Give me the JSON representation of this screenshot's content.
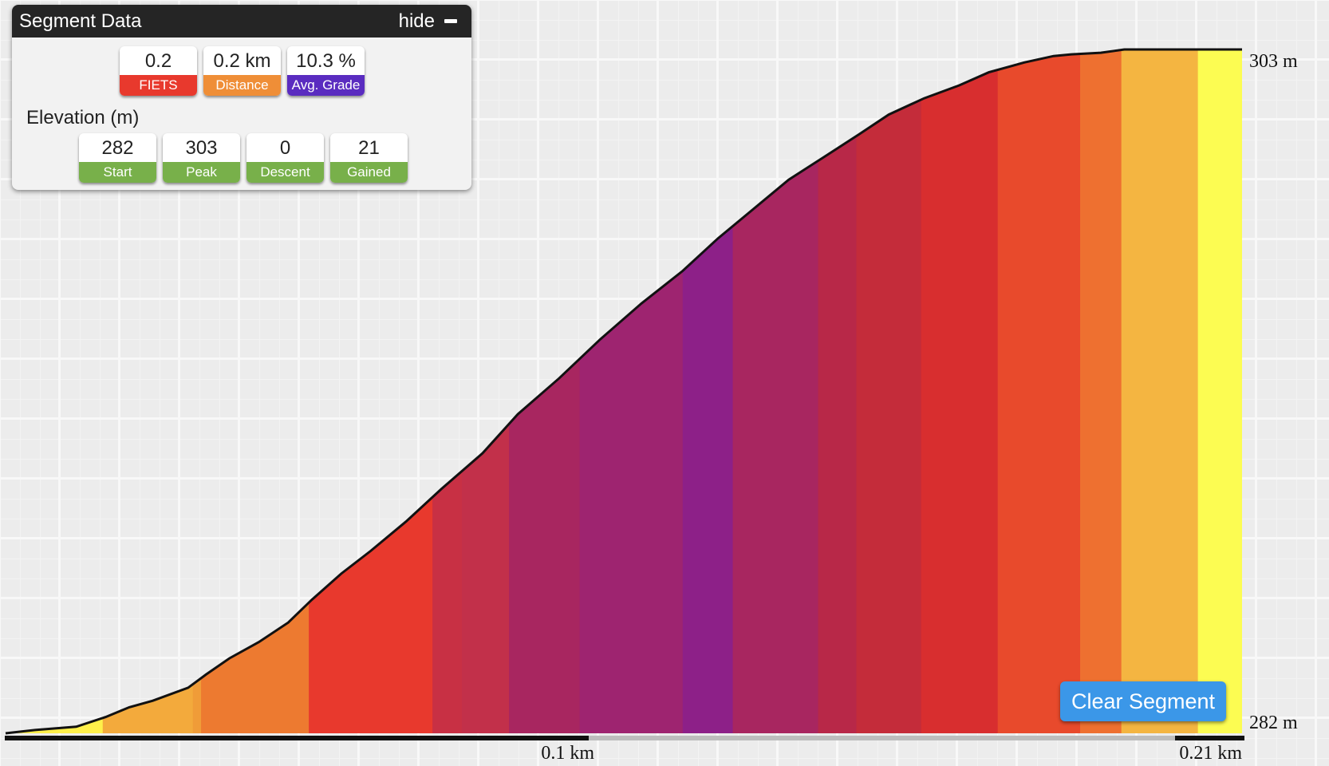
{
  "panel": {
    "title": "Segment Data",
    "hide_label": "hide",
    "hide_icon": "minus-icon",
    "summary": [
      {
        "value": "0.2",
        "label": "FIETS",
        "color": "#e8392d"
      },
      {
        "value": "0.2 km",
        "label": "Distance",
        "color": "#ef8e37"
      },
      {
        "value": "10.3 %",
        "label": "Avg. Grade",
        "color": "#5a2cc0"
      }
    ],
    "elevation_label": "Elevation (m)",
    "elevation": [
      {
        "value": "282",
        "label": "Start",
        "color": "#78b04a"
      },
      {
        "value": "303",
        "label": "Peak",
        "color": "#78b04a"
      },
      {
        "value": "0",
        "label": "Descent",
        "color": "#78b04a"
      },
      {
        "value": "21",
        "label": "Gained",
        "color": "#78b04a"
      }
    ]
  },
  "clear_button": "Clear Segment",
  "chart_data": {
    "type": "area",
    "title": "",
    "xlabel": "",
    "ylabel": "",
    "x_unit": "km",
    "y_unit": "m",
    "xlim": [
      0,
      0.21
    ],
    "ylim": [
      282,
      303
    ],
    "x_ticks": [
      {
        "value": 0.1,
        "label": "0.1 km"
      },
      {
        "value": 0.21,
        "label": "0.21 km"
      }
    ],
    "y_ticks": [
      {
        "value": 303,
        "label": "303 m"
      },
      {
        "value": 282,
        "label": "282 m"
      }
    ],
    "profile": {
      "x": [
        0,
        0.005,
        0.012,
        0.017,
        0.021,
        0.025,
        0.031,
        0.034,
        0.038,
        0.043,
        0.048,
        0.052,
        0.057,
        0.062,
        0.068,
        0.074,
        0.081,
        0.087,
        0.094,
        0.101,
        0.108,
        0.115,
        0.121,
        0.127,
        0.133,
        0.139,
        0.145,
        0.15,
        0.156,
        0.162,
        0.167,
        0.173,
        0.178,
        0.181,
        0.186,
        0.19,
        0.194,
        0.199,
        0.202,
        0.205,
        0.21
      ],
      "y": [
        282.0,
        282.1,
        282.2,
        282.5,
        282.8,
        283.0,
        283.4,
        283.8,
        284.3,
        284.8,
        285.4,
        286.1,
        286.9,
        287.6,
        288.5,
        289.5,
        290.6,
        291.8,
        292.9,
        294.1,
        295.2,
        296.2,
        297.2,
        298.1,
        299.0,
        299.7,
        300.4,
        301.0,
        301.5,
        301.9,
        302.3,
        302.6,
        302.8,
        302.85,
        302.9,
        303.0,
        303.0,
        303.0,
        303.0,
        303.0,
        303.0
      ]
    },
    "grade_bands": [
      {
        "x0": 0,
        "x1": 0.0165,
        "color": "#fff04a"
      },
      {
        "x0": 0.0165,
        "x1": 0.0318,
        "color": "#f3aa3c"
      },
      {
        "x0": 0.0318,
        "x1": 0.0332,
        "color": "#f09c38"
      },
      {
        "x0": 0.0332,
        "x1": 0.048,
        "color": "#ed7a30"
      },
      {
        "x0": 0.048,
        "x1": 0.0515,
        "color": "#ed7a30"
      },
      {
        "x0": 0.0515,
        "x1": 0.0725,
        "color": "#e8392d"
      },
      {
        "x0": 0.0725,
        "x1": 0.0775,
        "color": "#c83044"
      },
      {
        "x0": 0.0775,
        "x1": 0.0855,
        "color": "#c2304a"
      },
      {
        "x0": 0.0855,
        "x1": 0.0975,
        "color": "#a82660"
      },
      {
        "x0": 0.0975,
        "x1": 0.115,
        "color": "#9e2470"
      },
      {
        "x0": 0.115,
        "x1": 0.1235,
        "color": "#8d2088"
      },
      {
        "x0": 0.1235,
        "x1": 0.138,
        "color": "#a82660"
      },
      {
        "x0": 0.138,
        "x1": 0.1445,
        "color": "#b82848"
      },
      {
        "x0": 0.1445,
        "x1": 0.1555,
        "color": "#c42c3a"
      },
      {
        "x0": 0.1555,
        "x1": 0.1685,
        "color": "#d82e2f"
      },
      {
        "x0": 0.1685,
        "x1": 0.1825,
        "color": "#e84a2c"
      },
      {
        "x0": 0.1825,
        "x1": 0.1895,
        "color": "#ee7030"
      },
      {
        "x0": 0.1895,
        "x1": 0.2025,
        "color": "#f4b541"
      },
      {
        "x0": 0.2025,
        "x1": 0.21,
        "color": "#fcfc52"
      }
    ]
  }
}
